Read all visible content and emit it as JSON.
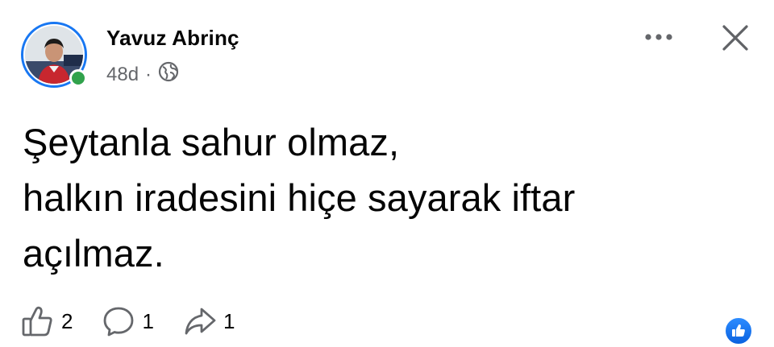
{
  "post": {
    "author": "Yavuz Abrinç",
    "time": "48d",
    "separator": "·",
    "text_lines": [
      "Şeytanla sahur olmaz,",
      "halkın iradesini hiçe sayarak iftar",
      "açılmaz."
    ]
  },
  "actions": {
    "like_count": "2",
    "comment_count": "1",
    "share_count": "1"
  },
  "icons": {
    "avatar": "profile-photo",
    "online_status": "online-dot",
    "privacy": "globe-icon",
    "more": "more-icon",
    "close": "close-icon",
    "like": "thumbs-up-icon",
    "comment": "comment-icon",
    "share": "share-icon",
    "reaction": "like-reaction-icon"
  },
  "colors": {
    "accent": "#1877f2",
    "online": "#31a24c",
    "secondary_text": "#65676b"
  }
}
